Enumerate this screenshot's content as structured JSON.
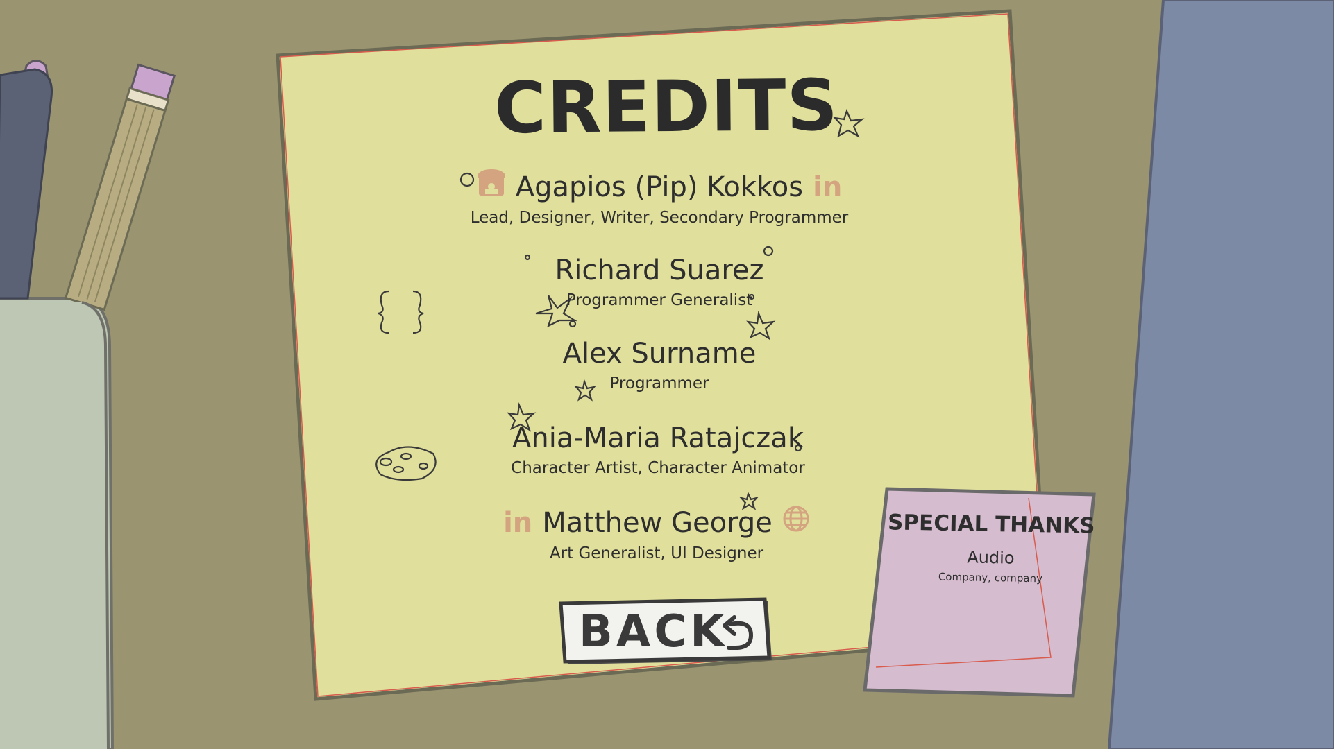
{
  "title": "CREDITS",
  "credits": [
    {
      "name": "Agapios (Pip) Kokkos",
      "role": "Lead, Designer, Writer, Secondary Programmer",
      "left_icon": "itch-store-icon",
      "right_icon": "linkedin-icon",
      "right_icon_text": "in"
    },
    {
      "name": "Richard Suarez",
      "role": "Programmer Generalist"
    },
    {
      "name": "Alex Surname",
      "role": "Programmer"
    },
    {
      "name": "Ania-Maria Ratajczak",
      "role": "Character Artist, Character Animator"
    },
    {
      "name": "Matthew George",
      "role": "Art Generalist, UI Designer",
      "left_icon": "linkedin-icon",
      "left_icon_text": "in",
      "right_icon": "globe-icon"
    }
  ],
  "back_button": {
    "label": "BACK",
    "icon": "undo-arrow-icon"
  },
  "special_thanks": {
    "title": "SPECIAL THANKS",
    "category": "Audio",
    "names": "Company, company"
  },
  "colors": {
    "desk": "#9b9470",
    "paper": "#e0df9c",
    "sticky_note": "#d6bccf",
    "link_icons": "#d4a37f",
    "ink": "#2b2b2b"
  }
}
